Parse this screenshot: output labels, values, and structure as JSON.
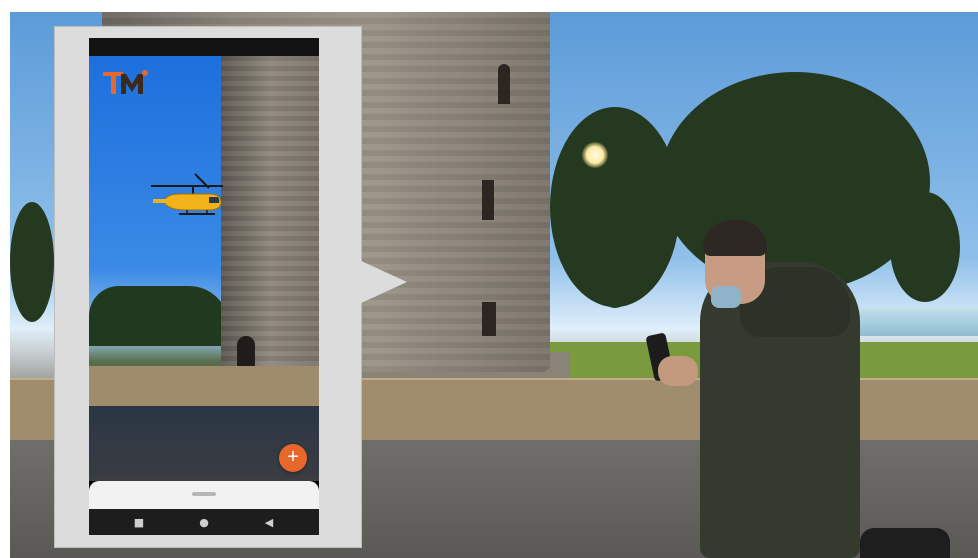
{
  "app": {
    "logo_icon": "tm-logo-icon",
    "ar_object_icon": "helicopter-icon",
    "fab_label": "+",
    "nav": {
      "recents_icon": "■",
      "home_icon": "●",
      "back_icon": "◀"
    }
  },
  "colors": {
    "fab": "#e8672a",
    "logo": "#e8672a",
    "helicopter": "#f2b31a"
  }
}
